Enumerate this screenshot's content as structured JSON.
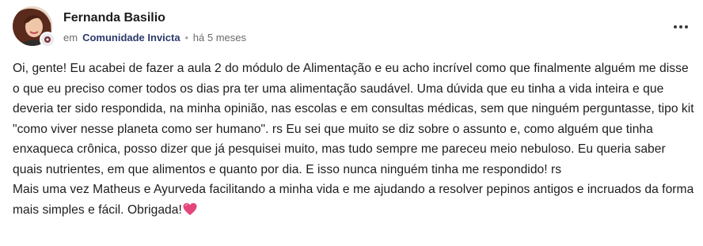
{
  "post": {
    "author": {
      "name": "Fernanda Basilio"
    },
    "meta": {
      "in_label": "em",
      "community": "Comunidade Invicta",
      "separator": "•",
      "time": "há 5 meses"
    },
    "icons": {
      "more": "more-horizontal-icon",
      "badge": "member-badge-icon",
      "heart": "pink-heart-icon"
    },
    "colors": {
      "community_link": "#2b3a6b",
      "meta_text": "#6b6b6b",
      "body_text": "#1c1c1c",
      "heart": "#e4457a"
    },
    "body": {
      "paragraph_1": "Oi, gente! Eu acabei de fazer a aula 2 do módulo de Alimentação e eu acho incrível como que finalmente alguém me disse o que eu preciso comer todos os dias pra ter uma alimentação saudável. Uma dúvida que eu tinha a vida inteira e que deveria ter sido respondida, na minha opinião, nas escolas e em consultas médicas, sem que ninguém perguntasse, tipo kit \"como viver nesse planeta como ser humano\". rs Eu sei que muito se diz sobre o assunto e, como alguém que tinha enxaqueca crônica, posso dizer que já pesquisei muito, mas tudo sempre me pareceu meio nebuloso. Eu queria saber quais nutrientes, em que alimentos e quanto por dia. E isso nunca ninguém tinha me respondido! rs",
      "paragraph_2": "Mais uma vez Matheus e Ayurveda facilitando a minha vida e me ajudando a resolver pepinos antigos e incruados da forma mais simples e fácil. Obrigada!"
    }
  }
}
